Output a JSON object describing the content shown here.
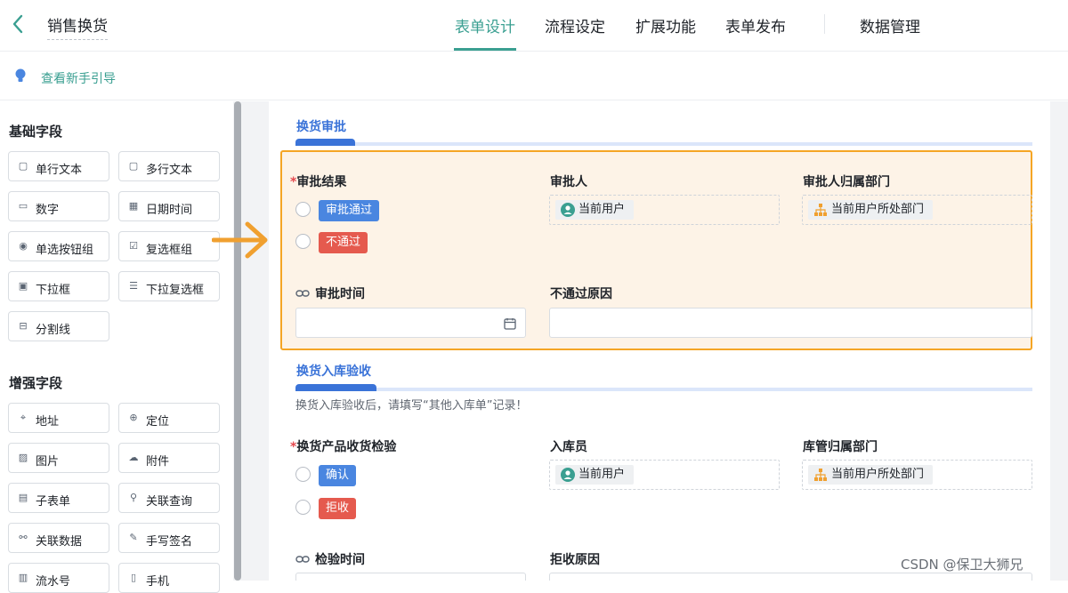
{
  "header": {
    "app_title": "销售换货",
    "nav": [
      "表单设计",
      "流程设定",
      "扩展功能",
      "表单发布",
      "数据管理"
    ]
  },
  "guide": {
    "label": "查看新手引导"
  },
  "sidebar": {
    "basic_title": "基础字段",
    "basic": [
      "单行文本",
      "多行文本",
      "数字",
      "日期时间",
      "单选按钮组",
      "复选框组",
      "下拉框",
      "下拉复选框",
      "分割线"
    ],
    "enhanced_title": "增强字段",
    "enhanced": [
      "地址",
      "定位",
      "图片",
      "附件",
      "子表单",
      "关联查询",
      "关联数据",
      "手写签名",
      "流水号",
      "手机"
    ]
  },
  "section1": {
    "title": "换货审批",
    "result_label": "审批结果",
    "required_mark": "*",
    "opt_pass": "审批通过",
    "opt_fail": "不通过",
    "approver_label": "审批人",
    "approver_value": "当前用户",
    "dept_label": "审批人归属部门",
    "dept_value": "当前用户所处部门",
    "time_label": "审批时间",
    "reason_label": "不通过原因"
  },
  "section2": {
    "title": "换货入库验收",
    "note": "换货入库验收后，请填写“其他入库单”记录！",
    "check_label": "换货产品收货检验",
    "required_mark": "*",
    "opt_confirm": "确认",
    "opt_reject": "拒收",
    "receiver_label": "入库员",
    "receiver_value": "当前用户",
    "dept_label": "库管归属部门",
    "dept_value": "当前用户所处部门",
    "time_label": "检验时间",
    "reason_label": "拒收原因"
  },
  "watermark": "CSDN @保卫大狮兄",
  "colors": {
    "accent": "#3a9f91",
    "section": "#3a73d8",
    "highlight_border": "#f5a524",
    "tag_blue": "#4a86e0",
    "tag_red": "#e55a4e"
  }
}
